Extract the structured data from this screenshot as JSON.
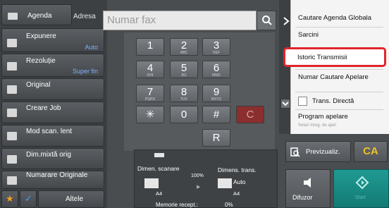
{
  "left": {
    "agenda_label": "Agenda",
    "address_label": "Adresa",
    "items": [
      {
        "label": "Expunere",
        "value": "Auto",
        "icon": "exposure-icon"
      },
      {
        "label": "Rezoluție",
        "value": "Super fin",
        "icon": "resolution-icon"
      },
      {
        "label": "Original",
        "value": "",
        "icon": "original-icon"
      },
      {
        "label": "Creare Job",
        "value": "",
        "icon": "job-build-icon"
      },
      {
        "label": "Mod scan. lent",
        "value": "",
        "icon": "slow-scan-icon"
      },
      {
        "label": "Dim.mixtă orig",
        "value": "",
        "icon": "mixed-size-icon"
      },
      {
        "label": "Numarare Originale",
        "value": "",
        "icon": "original-count-icon"
      }
    ],
    "other_label": "Altele"
  },
  "fax": {
    "placeholder": "Numar fax"
  },
  "keypad": [
    {
      "num": "1",
      "sub": ""
    },
    {
      "num": "2",
      "sub": "ABC"
    },
    {
      "num": "3",
      "sub": "DEF"
    },
    {
      "num": "4",
      "sub": "GHI"
    },
    {
      "num": "5",
      "sub": "JKL"
    },
    {
      "num": "6",
      "sub": "MNO"
    },
    {
      "num": "7",
      "sub": "PQRS"
    },
    {
      "num": "8",
      "sub": "TUV"
    },
    {
      "num": "9",
      "sub": "WXYZ"
    },
    {
      "num": "✳",
      "sub": ""
    },
    {
      "num": "0",
      "sub": ""
    },
    {
      "num": "#",
      "sub": ""
    },
    {
      "num": "C",
      "sub": ""
    },
    {
      "num": "R",
      "sub": ""
    }
  ],
  "status": {
    "scan_size_label": "Dimen. scanare",
    "send_size_label": "Dimens. trans.",
    "percent": "100%",
    "send_value": "Auto",
    "paper_left": "A4",
    "paper_right": "A4",
    "memory_label": "Memorie recept.:",
    "memory_value": "0%"
  },
  "right": {
    "items": [
      {
        "label": "Cautare Agenda Globala"
      },
      {
        "label": "Sarcini"
      },
      {
        "label": "Istoric Transmisii"
      },
      {
        "label": "Numar Cautare Apelare"
      },
      {
        "label": "Trans. Directă"
      },
      {
        "label": "Program apelare",
        "sub": "Setari inreg. de apel"
      }
    ],
    "preview_label": "Previzualiz.",
    "ca_label": "CA",
    "speaker_label": "Difuzor",
    "start_label": "Start"
  },
  "colors": {
    "highlight": "#e0252a",
    "start": "#1f9a93",
    "value_blue": "#7fb0ff",
    "ca": "#f0c020"
  }
}
